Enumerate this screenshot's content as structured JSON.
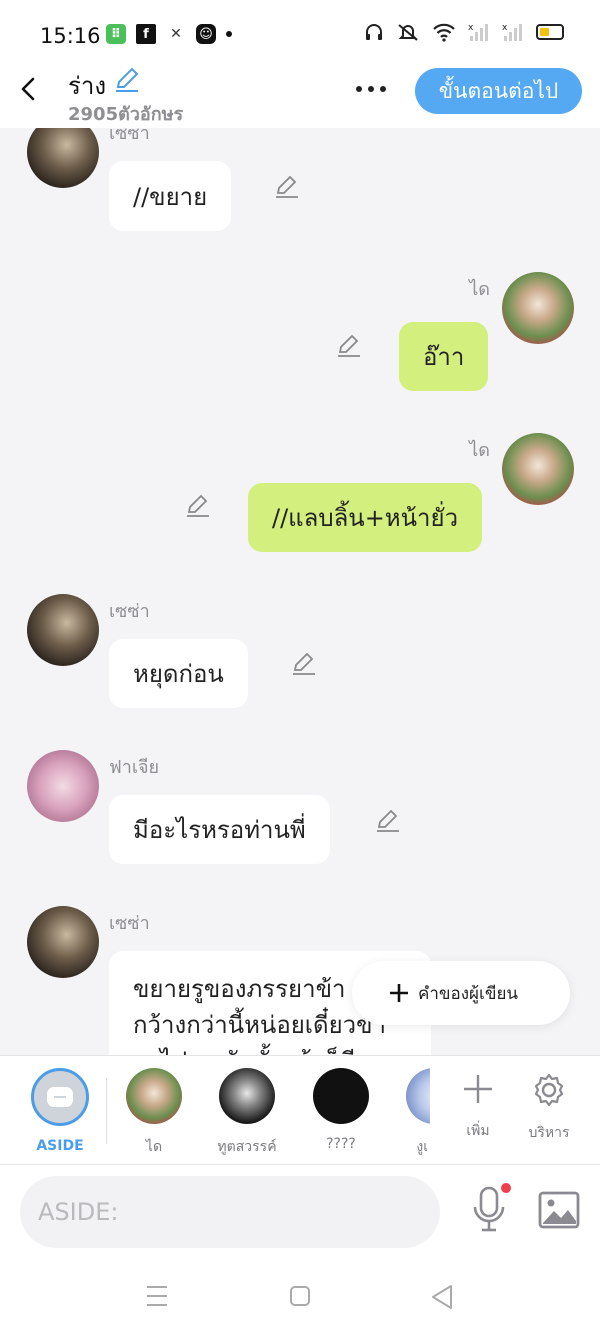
{
  "status_bar": {
    "time": "15:16",
    "app_icons": [
      "app-green-icon",
      "facebook-icon",
      "game-icon",
      "app-face-icon"
    ],
    "right_icons": [
      "headphones-icon",
      "mute-icon",
      "wifi-icon",
      "signal-icon",
      "signal-icon",
      "battery-icon"
    ]
  },
  "header": {
    "title": "ร่าง",
    "char_count": "2905ตัวอักษร",
    "next_button": "ขั้นตอนต่อไป"
  },
  "messages": [
    {
      "sender": "เซซ่า",
      "text": "//ขยาย",
      "side": "left"
    },
    {
      "sender": "ได",
      "text": "อ๊าา",
      "side": "right"
    },
    {
      "sender": "ได",
      "text": "//แลบลิ้น+หน้ายั่ว",
      "side": "right"
    },
    {
      "sender": "เซซ่า",
      "text": "หยุดก่อน",
      "side": "left"
    },
    {
      "sender": "ฟาเจีย",
      "text": "มีอะไรหรอท่านพี่",
      "side": "left"
    },
    {
      "sender": "เซซ่า",
      "text": "ขยายรูของภรรยาข้า\nกว้างกว่านี้หน่อยเดี๋ยวข้า\nจะไปเอาอันนั้นเข้าก็ดี",
      "side": "left"
    }
  ],
  "author_button": "คำของผู้เขียน",
  "characters": [
    {
      "label": "ASIDE",
      "selected": true
    },
    {
      "label": "ได"
    },
    {
      "label": "ทูตสวรรค์"
    },
    {
      "label": "????"
    },
    {
      "label": "งูเ"
    }
  ],
  "tools": {
    "add_label": "เพิ่ม",
    "manage_label": "บริหาร"
  },
  "input": {
    "placeholder": "ASIDE:"
  },
  "colors": {
    "accent": "#55a9f2",
    "green_bubble": "#d3ef7e",
    "aside_blue": "#4a9de6"
  }
}
